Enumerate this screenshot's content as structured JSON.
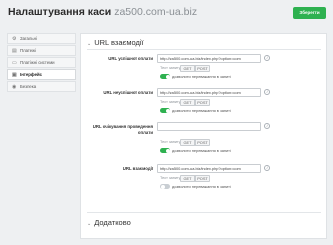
{
  "header": {
    "title": "Налаштування каси",
    "site": "za500.com-ua.biz",
    "save_label": "Зберегти"
  },
  "sidebar": {
    "items": [
      {
        "label": "Загальні",
        "icon": "gear-icon"
      },
      {
        "label": "Платежі",
        "icon": "document-icon"
      },
      {
        "label": "Платіжні системи",
        "icon": "wallet-icon"
      },
      {
        "label": "Інтерфейс",
        "icon": "interface-icon",
        "active": true
      },
      {
        "label": "Безпека",
        "icon": "shield-icon"
      }
    ]
  },
  "main": {
    "section1_title": "URL взаємодії",
    "section2_title": "Додатково",
    "test_label": "Тест запиту",
    "get_label": "GET",
    "post_label": "POST",
    "toggle_label": "дозволити переважання в запиті",
    "info_glyph": "i",
    "rows": [
      {
        "label": "URL успішної оплати",
        "value": "http://za500.com-ua.biz/index.php?option=com",
        "toggle_on": true
      },
      {
        "label": "URL неуспішної оплати",
        "value": "http://za500.com-ua.biz/index.php?option=com",
        "toggle_on": true
      },
      {
        "label": "URL очікування проведення оплати",
        "value": "",
        "toggle_on": true
      },
      {
        "label": "URL взаємодії",
        "value": "http://za500.com-ua.biz/index.php?option=com",
        "toggle_on": false
      }
    ]
  },
  "colors": {
    "accent": "#2eb150",
    "background": "#eef0f2",
    "panel": "#ffffff"
  }
}
